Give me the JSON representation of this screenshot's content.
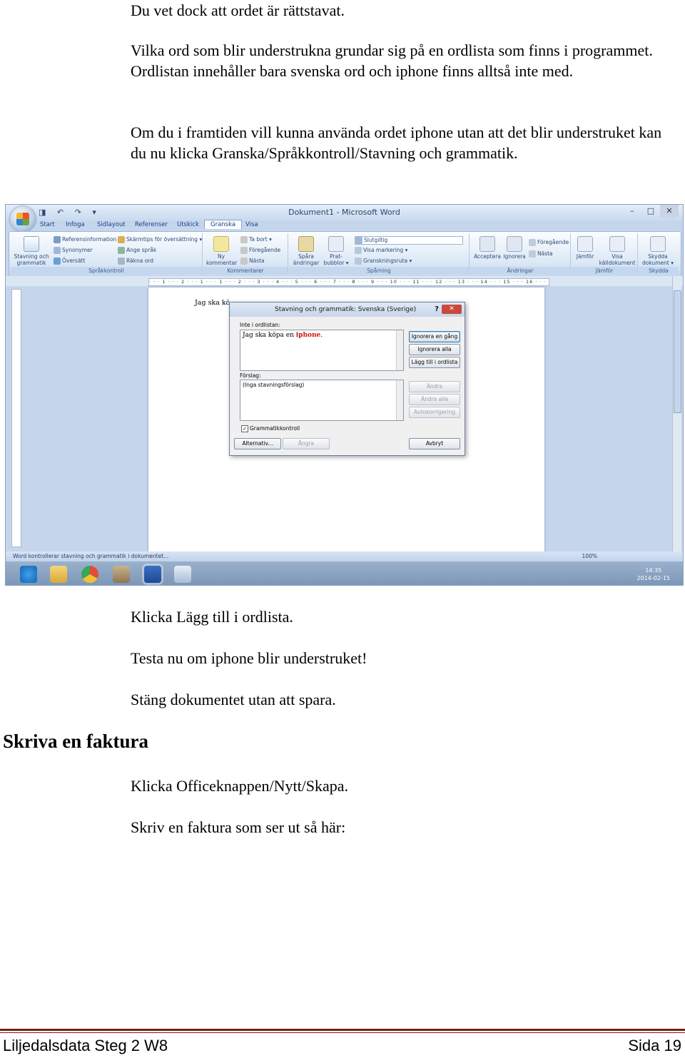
{
  "paragraphs": {
    "p0": "Du vet dock att ordet är rättstavat.",
    "p1": "Vilka ord som blir understrukna grundar sig på en ordlista som finns i programmet. Ordlistan innehåller bara svenska ord och iphone finns alltså inte med.",
    "p2": "Om du i framtiden vill kunna använda ordet iphone utan att det blir understruket kan du nu klicka Granska/Språkkontroll/Stavning och grammatik.",
    "p3": "Klicka Lägg till i ordlista.",
    "p4": "Testa nu om iphone blir understruket!",
    "p5": "Stäng dokumentet utan att spara.",
    "heading": "Skriva en faktura",
    "p6": "Klicka Officeknappen/Nytt/Skapa.",
    "p7": "Skriv en faktura som ser ut så här:"
  },
  "footer": {
    "left": "Liljedalsdata Steg 2 W8",
    "right": "Sida 19"
  },
  "screenshot": {
    "window_title": "Dokument1 - Microsoft Word",
    "qat": "◨ ↶ ↷ ▾",
    "win_min": "–",
    "win_max": "□",
    "win_close": "✕",
    "tabs": [
      "Start",
      "Infoga",
      "Sidlayout",
      "Referenser",
      "Utskick",
      "Granska",
      "Visa"
    ],
    "ribbon": {
      "sprak": {
        "label": "Språkkontroll",
        "big": "Stavning och\ngrammatik",
        "items": [
          "Referensinformation",
          "Synonymer",
          "Översätt",
          "Skärmtips för översättning ▾",
          "Ange språk",
          "Räkna ord"
        ]
      },
      "komm": {
        "label": "Kommentarer",
        "big": "Ny\nkommentar",
        "items": [
          "Ta bort ▾",
          "Föregående",
          "Nästa"
        ]
      },
      "sparning": {
        "label": "Spårning",
        "big1": "Spåra\nändringar ▾",
        "big2": "Prat-\nbubblor ▾",
        "items": [
          "Slutgiltig",
          "Visa markering ▾",
          "Granskningsruta ▾"
        ]
      },
      "andringar": {
        "label": "Ändringar",
        "big1": "Acceptera",
        "big2": "Ignorera",
        "items": [
          "Föregående",
          "Nästa"
        ]
      },
      "jamfor": {
        "label": "Jämför",
        "big1": "Jämför",
        "big2": "Visa\nkälldokument ▾"
      },
      "skydda": {
        "label": "Skydda",
        "big": "Skydda\ndokument ▾"
      }
    },
    "ruler": "· · · 1 · · · 2 · · · 1 · · · 1 · · · 2 · · · 3 · · · 4 · · · 5 · · · 6 · · · 7 · · · 8 · · · 9 · · · 10 · · · 11 · · · 12 · · · 13 · · · 14 · · · 15 · · · 16 · · · 17 · · · 18",
    "doc_text": "Jag ska kö",
    "statusbar": "Word kontrollerar stavning och grammatik i dokumentet...",
    "zoom": "100%",
    "clock_time": "14:35",
    "clock_date": "2014-02-15",
    "dialog": {
      "title": "Stavning och grammatik: Svenska (Sverige)",
      "help": "?",
      "close": "✕",
      "not_in_dict_label": "Inte i ordlistan:",
      "sentence_prefix": "Jag ska köpa en ",
      "sentence_word": "iphone",
      "sentence_suffix": ".",
      "suggestions_label": "Förslag:",
      "suggestions_value": "(Inga stavningsförslag)",
      "grammar_check": "Grammatikkontroll",
      "buttons": {
        "ignore_once": "Ignorera en gång",
        "ignore_all": "Ignorera alla",
        "add": "Lägg till i ordlista",
        "change": "Ändra",
        "change_all": "Ändra alla",
        "autocorrect": "Autokorrigering",
        "options": "Alternativ...",
        "undo": "Ångra",
        "cancel": "Avbryt"
      }
    }
  }
}
